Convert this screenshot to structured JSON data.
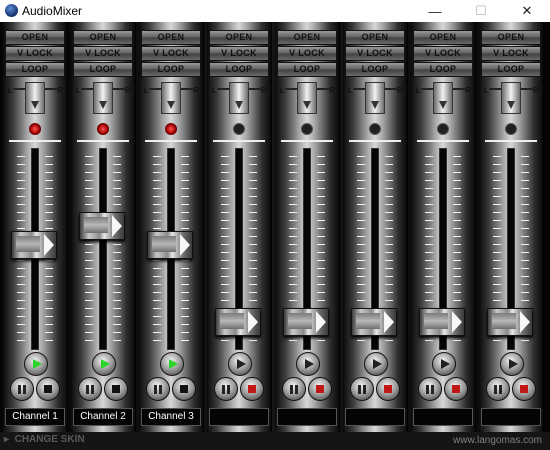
{
  "window": {
    "title": "AudioMixer",
    "minimize": "—",
    "maximize": "☐",
    "close": "✕"
  },
  "labels": {
    "open": "OPEN",
    "vlock": "V LOCK",
    "loop": "LOOP",
    "pan_left": "L",
    "pan_right": "R"
  },
  "channels": [
    {
      "name": "Channel 1",
      "led_on": true,
      "volume": 0.5,
      "playing": true
    },
    {
      "name": "Channel 2",
      "led_on": true,
      "volume": 0.6,
      "playing": true
    },
    {
      "name": "Channel 3",
      "led_on": true,
      "volume": 0.5,
      "playing": true
    },
    {
      "name": "",
      "led_on": false,
      "volume": 0.1,
      "playing": false
    },
    {
      "name": "",
      "led_on": false,
      "volume": 0.1,
      "playing": false
    },
    {
      "name": "",
      "led_on": false,
      "volume": 0.1,
      "playing": false
    },
    {
      "name": "",
      "led_on": false,
      "volume": 0.1,
      "playing": false
    },
    {
      "name": "",
      "led_on": false,
      "volume": 0.1,
      "playing": false
    }
  ],
  "footer": {
    "skin_arrow": "▸",
    "change_skin": "CHANGE SKIN",
    "website": "www.langomas.com"
  },
  "icons": {
    "app": "app-icon",
    "play": "play-icon",
    "pause": "pause-icon",
    "stop": "stop-icon"
  }
}
